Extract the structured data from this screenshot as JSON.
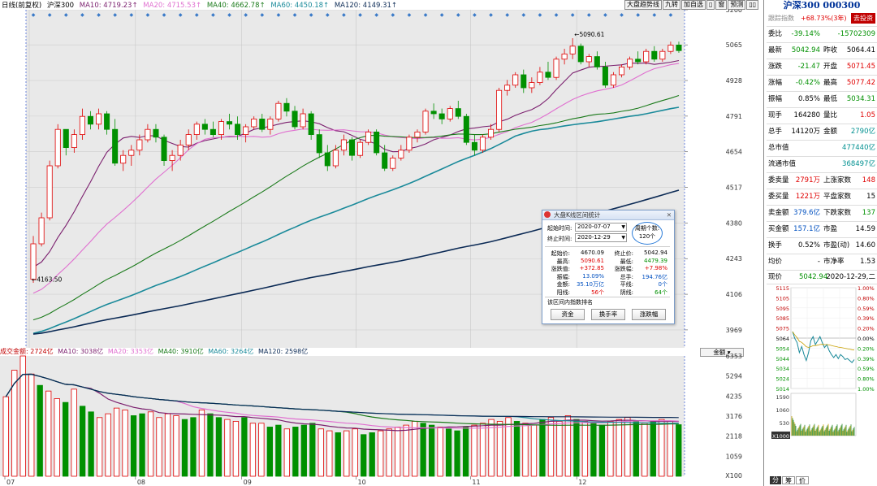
{
  "legend": {
    "title": "日线(前复权)",
    "index_name": "沪深300",
    "ma10": "MA10: 4719.23↑",
    "ma20": "MA20: 4715.53↑",
    "ma40": "MA40: 4662.78↑",
    "ma60": "MA60: 4450.18↑",
    "ma120": "MA120: 4149.31↑"
  },
  "toolbar": [
    "大盘趋势线",
    "九转",
    "加自选",
    "▯",
    "窗",
    "预测",
    "▯▯"
  ],
  "vol_legend": {
    "title": "成交金额: 2724亿",
    "ma10": "MA10: 3038亿",
    "ma20": "MA20: 3353亿",
    "ma40": "MA40: 3910亿",
    "ma60": "MA60: 3264亿",
    "ma120": "MA120: 2598亿"
  },
  "vol_selector": "金额",
  "price_axis": [
    "5200",
    "5065",
    "4928",
    "4791",
    "4654",
    "4517",
    "4380",
    "4243",
    "4106",
    "3969"
  ],
  "vol_axis": [
    "6353",
    "5294",
    "4235",
    "3176",
    "2118",
    "1059",
    "X100"
  ],
  "date_axis": [
    "07",
    "08",
    "09",
    "10",
    "11",
    "12"
  ],
  "annotations": {
    "high": "5090.61",
    "low": "4163.50"
  },
  "colors": {
    "up": "#e00000",
    "down": "#009000",
    "ma10": "#7b1f6e",
    "ma20": "#e070d0",
    "ma40": "#1a7a1a",
    "ma60": "#1a8a9a",
    "ma120": "#0b2a55"
  },
  "chart_data": {
    "type": "candlestick",
    "title": "沪深300 日线(前复权)",
    "period": [
      "2020-07-01",
      "2020-12-31"
    ],
    "ylim": [
      3900,
      5200
    ],
    "candles_ohlc": [
      [
        4163.5,
        4330,
        4150,
        4300
      ],
      [
        4300,
        4420,
        4290,
        4400
      ],
      [
        4400,
        4620,
        4390,
        4600
      ],
      [
        4600,
        4760,
        4590,
        4740
      ],
      [
        4740,
        4740,
        4640,
        4670
      ],
      [
        4670,
        4740,
        4650,
        4720
      ],
      [
        4720,
        4820,
        4700,
        4790
      ],
      [
        4790,
        4810,
        4740,
        4760
      ],
      [
        4760,
        4820,
        4740,
        4800
      ],
      [
        4800,
        4810,
        4720,
        4740
      ],
      [
        4740,
        4780,
        4600,
        4610
      ],
      [
        4610,
        4660,
        4580,
        4640
      ],
      [
        4640,
        4680,
        4600,
        4660
      ],
      [
        4660,
        4720,
        4640,
        4700
      ],
      [
        4700,
        4760,
        4690,
        4740
      ],
      [
        4740,
        4760,
        4690,
        4710
      ],
      [
        4710,
        4720,
        4600,
        4620
      ],
      [
        4620,
        4660,
        4580,
        4640
      ],
      [
        4640,
        4700,
        4620,
        4680
      ],
      [
        4680,
        4740,
        4660,
        4720
      ],
      [
        4720,
        4770,
        4700,
        4760
      ],
      [
        4760,
        4780,
        4720,
        4740
      ],
      [
        4740,
        4770,
        4710,
        4720
      ],
      [
        4720,
        4780,
        4700,
        4770
      ],
      [
        4770,
        4800,
        4740,
        4760
      ],
      [
        4760,
        4790,
        4700,
        4720
      ],
      [
        4720,
        4760,
        4690,
        4750
      ],
      [
        4750,
        4790,
        4740,
        4780
      ],
      [
        4780,
        4800,
        4730,
        4740
      ],
      [
        4740,
        4790,
        4720,
        4780
      ],
      [
        4780,
        4850,
        4770,
        4840
      ],
      [
        4840,
        4860,
        4790,
        4810
      ],
      [
        4810,
        4830,
        4740,
        4750
      ],
      [
        4750,
        4820,
        4740,
        4800
      ],
      [
        4800,
        4810,
        4700,
        4720
      ],
      [
        4720,
        4740,
        4630,
        4650
      ],
      [
        4650,
        4680,
        4580,
        4600
      ],
      [
        4600,
        4680,
        4590,
        4660
      ],
      [
        4660,
        4720,
        4640,
        4700
      ],
      [
        4700,
        4710,
        4620,
        4640
      ],
      [
        4640,
        4700,
        4630,
        4690
      ],
      [
        4690,
        4740,
        4680,
        4730
      ],
      [
        4730,
        4740,
        4640,
        4650
      ],
      [
        4650,
        4680,
        4580,
        4590
      ],
      [
        4590,
        4640,
        4580,
        4630
      ],
      [
        4630,
        4680,
        4620,
        4660
      ],
      [
        4660,
        4720,
        4650,
        4710
      ],
      [
        4710,
        4740,
        4690,
        4730
      ],
      [
        4730,
        4820,
        4720,
        4810
      ],
      [
        4810,
        4840,
        4780,
        4800
      ],
      [
        4800,
        4820,
        4760,
        4780
      ],
      [
        4780,
        4830,
        4770,
        4820
      ],
      [
        4820,
        4850,
        4780,
        4790
      ],
      [
        4790,
        4800,
        4680,
        4690
      ],
      [
        4690,
        4720,
        4640,
        4660
      ],
      [
        4660,
        4720,
        4650,
        4710
      ],
      [
        4710,
        4760,
        4700,
        4740
      ],
      [
        4740,
        4900,
        4730,
        4890
      ],
      [
        4890,
        4930,
        4870,
        4910
      ],
      [
        4910,
        4960,
        4900,
        4950
      ],
      [
        4950,
        4970,
        4880,
        4900
      ],
      [
        4900,
        4940,
        4880,
        4920
      ],
      [
        4920,
        4980,
        4910,
        4960
      ],
      [
        4960,
        5000,
        4930,
        4940
      ],
      [
        4940,
        5020,
        4930,
        5010
      ],
      [
        5010,
        5050,
        4990,
        5030
      ],
      [
        5030,
        5090.61,
        5010,
        5060
      ],
      [
        5060,
        5070,
        4990,
        5000
      ],
      [
        5000,
        5030,
        4980,
        5020
      ],
      [
        5020,
        5040,
        4970,
        4980
      ],
      [
        4980,
        5000,
        4900,
        4910
      ],
      [
        4910,
        4960,
        4900,
        4950
      ],
      [
        4950,
        4990,
        4940,
        4980
      ],
      [
        4980,
        5020,
        4970,
        5010
      ],
      [
        5010,
        5040,
        4990,
        5000
      ],
      [
        5000,
        5050,
        4990,
        5040
      ],
      [
        5040,
        5060,
        5000,
        5010
      ],
      [
        5010,
        5050,
        5000,
        5040
      ],
      [
        5040,
        5077.42,
        5030,
        5064
      ],
      [
        5064.41,
        5077.42,
        5034.31,
        5042.94
      ]
    ],
    "vol_values_yi": [
      4200,
      5600,
      6353,
      5400,
      4800,
      4500,
      4100,
      3900,
      4600,
      3700,
      3400,
      3100,
      3300,
      3600,
      3500,
      3200,
      3300,
      3400,
      3100,
      3300,
      3200,
      3000,
      3100,
      3500,
      3300,
      3100,
      3000,
      2900,
      3100,
      2800,
      2800,
      2600,
      2700,
      2500,
      2600,
      2700,
      2800,
      2500,
      2400,
      2300,
      2400,
      2500,
      2200,
      2300,
      2400,
      2500,
      2600,
      2700,
      2900,
      2800,
      2700,
      2600,
      2500,
      2400,
      2600,
      2700,
      2800,
      3000,
      2900,
      3100,
      2900,
      2800,
      2700,
      3000,
      3100,
      2900,
      3200,
      3000,
      2900,
      2800,
      2700,
      2900,
      3000,
      3100,
      2900,
      2800,
      2900,
      3000,
      2900,
      2724
    ],
    "xlabel": "",
    "ylabel": ""
  },
  "right_panel": {
    "title": "沪深300 000300",
    "badge": "去投资",
    "row0": {
      "l": "跟踪指数",
      "v": "+68.73%(3年)"
    },
    "rows": [
      {
        "l": "委比",
        "v1": "-39.14%",
        "c1": "green",
        "l2": "",
        "v2": "-15702309",
        "c2": "green"
      },
      {
        "l": "最新",
        "v1": "5042.94",
        "c1": "green",
        "l2": "昨收",
        "v2": "5064.41",
        "c2": ""
      },
      {
        "l": "涨跌",
        "v1": "-21.47",
        "c1": "green",
        "l2": "开盘",
        "v2": "5071.45",
        "c2": "red"
      },
      {
        "l": "涨幅",
        "v1": "-0.42%",
        "c1": "green",
        "l2": "最高",
        "v2": "5077.42",
        "c2": "red"
      },
      {
        "l": "振幅",
        "v1": "0.85%",
        "c1": "",
        "l2": "最低",
        "v2": "5034.31",
        "c2": "green"
      },
      {
        "l": "现手",
        "v1": "164280",
        "c1": "",
        "l2": "量比",
        "v2": "1.05",
        "c2": "red"
      },
      {
        "l": "总手",
        "v1": "14120万",
        "c1": "",
        "l2": "金额",
        "v2": "2790亿",
        "c2": "teal"
      }
    ],
    "cap": [
      {
        "l": "总市值",
        "v": "477440亿"
      },
      {
        "l": "流通市值",
        "v": "368497亿"
      }
    ],
    "rows2": [
      {
        "l": "委卖量",
        "v1": "2791万",
        "c1": "red",
        "l2": "上涨家数",
        "v2": "148",
        "c2": "red"
      },
      {
        "l": "委买量",
        "v1": "1221万",
        "c1": "red",
        "l2": "平盘家数",
        "v2": "15",
        "c2": ""
      },
      {
        "l": "卖金额",
        "v1": "379.6亿",
        "c1": "blue",
        "l2": "下跌家数",
        "v2": "137",
        "c2": "green"
      },
      {
        "l": "买金额",
        "v1": "157.1亿",
        "c1": "blue",
        "l2": "市盈",
        "v2": "14.59",
        "c2": ""
      },
      {
        "l": "换手",
        "v1": "0.52%",
        "c1": "",
        "l2": "市盈(动)",
        "v2": "14.60",
        "c2": ""
      },
      {
        "l": "均价",
        "v1": "-",
        "c1": "",
        "l2": "市净率",
        "v2": "1.53",
        "c2": ""
      }
    ],
    "now": {
      "label": "现价",
      "price": "5042.94",
      "date": "2020-12-29,二"
    },
    "mini_left": [
      "5115",
      "5105",
      "5095",
      "5085",
      "5075",
      "5064",
      "5054",
      "5044",
      "5034",
      "5024",
      "5014"
    ],
    "mini_right": [
      "1.00%",
      "0.80%",
      "0.59%",
      "0.39%",
      "0.20%",
      "0.00%",
      "0.20%",
      "0.39%",
      "0.59%",
      "0.80%",
      "1.00%"
    ],
    "mini_vol_axis": [
      "1590",
      "1060",
      "530",
      "X1000"
    ],
    "tabs": [
      "分",
      "筹",
      "价"
    ]
  },
  "dialog": {
    "title": "大盘K线区间统计",
    "start_label": "起始时间:",
    "start": "2020-07-07",
    "end_label": "终止时间:",
    "end": "2020-12-29",
    "count_label": "周期个数:",
    "count": "120个",
    "stats": [
      {
        "l": "起始价:",
        "v": "4670.09",
        "c": "",
        "l2": "终止价:",
        "v2": "5042.94",
        "c2": ""
      },
      {
        "l": "最高:",
        "v": "5090.61",
        "c": "red",
        "l2": "最低:",
        "v2": "4479.39",
        "c2": "green"
      },
      {
        "l": "涨跌值:",
        "v": "+372.85",
        "c": "red",
        "l2": "涨跌幅:",
        "v2": "+7.98%",
        "c2": "red"
      },
      {
        "l": "振幅:",
        "v": "13.09%",
        "c": "blue",
        "l2": "总手:",
        "v2": "194.76亿",
        "c2": "blue"
      },
      {
        "l": "金额:",
        "v": "35.10万亿",
        "c": "blue",
        "l2": "平线:",
        "v2": "0个",
        "c2": "blue"
      },
      {
        "l": "阳线:",
        "v": "56个",
        "c": "red",
        "l2": "阴线:",
        "v2": "64个",
        "c2": "green"
      }
    ],
    "rank_label": "该区间内指数排名",
    "buttons": [
      "资金",
      "换手率",
      "涨跌幅"
    ]
  }
}
